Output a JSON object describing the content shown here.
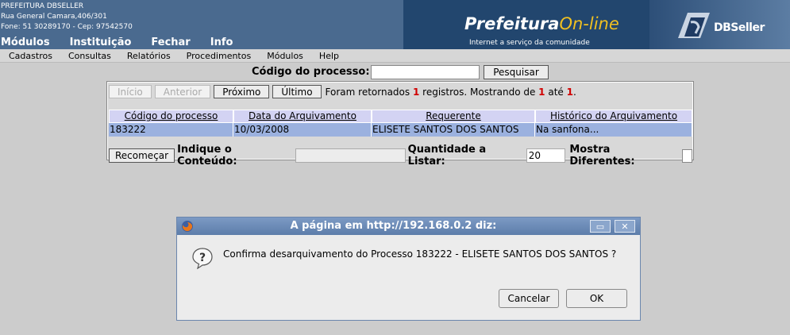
{
  "header": {
    "org_name": "PREFEITURA DBSELLER",
    "address": "Rua General Camara,406/301",
    "contact": "Fone: 51 30289170  -  Cep: 97542570",
    "brand_a": "Prefeitura",
    "brand_b": "On-line",
    "brand_tagline": "Internet a serviço da comunidade",
    "partner_logo": "DBSeller",
    "nav": [
      "Módulos",
      "Instituição",
      "Fechar",
      "Info"
    ]
  },
  "menubar": [
    "Cadastros",
    "Consultas",
    "Relatórios",
    "Procedimentos",
    "Módulos",
    "Help"
  ],
  "search": {
    "label": "Código do processo:",
    "value": "",
    "button": "Pesquisar"
  },
  "pager": {
    "first": "Início",
    "prev": "Anterior",
    "next": "Próximo",
    "last": "Último",
    "msg_a": "Foram retornados",
    "count": "1",
    "msg_b": "registros. Mostrando de",
    "from": "1",
    "msg_c": "até",
    "to": "1",
    "msg_d": "."
  },
  "table": {
    "headers": [
      "Código do processo",
      "Data do Arquivamento",
      "Requerente",
      "Histórico do Arquivamento"
    ],
    "rows": [
      [
        "183222",
        "10/03/2008",
        "ELISETE SANTOS DOS SANTOS",
        "Na sanfona..."
      ]
    ]
  },
  "filters": {
    "restart": "Recomeçar",
    "content_label": "Indique o Conteúdo:",
    "content_value": "",
    "qty_label": "Quantidade a Listar:",
    "qty_value": "20",
    "diff_label": "Mostra Diferentes:"
  },
  "dialog": {
    "title": "A página em http://192.168.0.2 diz:",
    "message": "Confirma desarquivamento do Processo 183222 - ELISETE SANTOS DOS SANTOS ?",
    "cancel": "Cancelar",
    "ok": "OK",
    "maximize_glyph": "▭",
    "close_glyph": "✕"
  },
  "colors": {
    "header_bg": "#4a6a8f",
    "table_header_bg": "#d3d3f3",
    "table_row_bg": "#9bb1df",
    "highlight_red": "#d00000"
  }
}
